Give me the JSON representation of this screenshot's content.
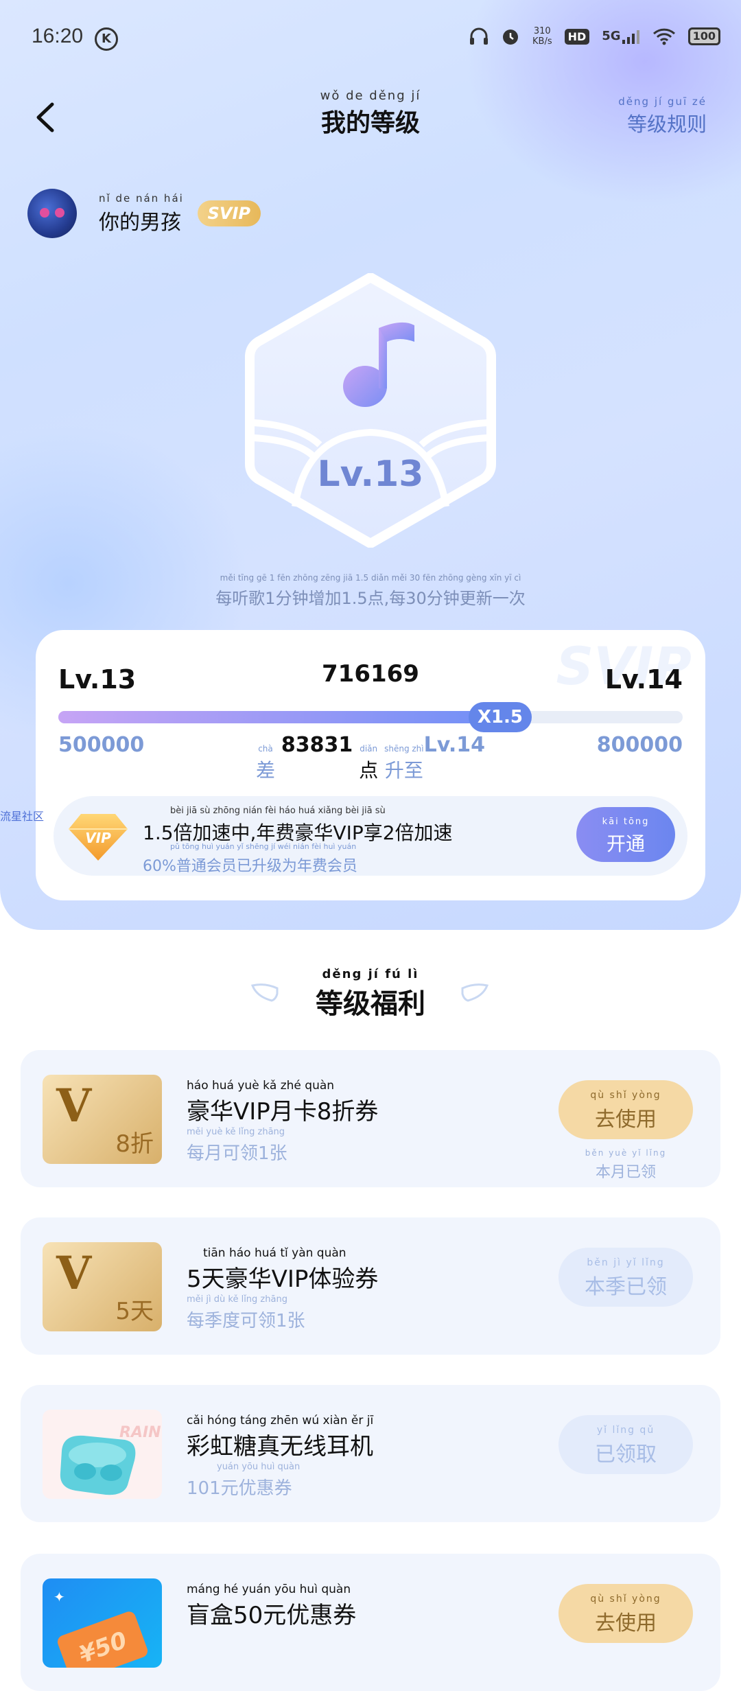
{
  "status_bar": {
    "time": "16:20",
    "k_badge": "K",
    "net_speed": "310",
    "net_unit": "KB/s",
    "hd": "HD",
    "network": "5G",
    "battery": "100"
  },
  "header": {
    "title": "我的等级",
    "title_pinyin": "wǒ de děng jí",
    "rules": "等级规则",
    "rules_pinyin": "děng jí guī zé"
  },
  "user": {
    "name": "你的男孩",
    "name_pinyin": "nǐ de nán hái",
    "badge": "SVIP"
  },
  "badge": {
    "level": "Lv.13"
  },
  "level_rule": {
    "text": "每听歌1分钟增加1.5点,每30分钟更新一次",
    "pinyin": "měi tīng gē 1 fēn zhōng zēng jiā 1.5 diǎn měi 30 fēn zhōng gèng xīn yī cì"
  },
  "progress": {
    "watermark": "SVIP",
    "current_level": "Lv.13",
    "next_level": "Lv.14",
    "score": "716169",
    "min": "500000",
    "max": "800000",
    "fraction": 0.723,
    "multiplier": "X1.5",
    "gap_prefix": "差",
    "gap_prefix_pinyin": "chà",
    "gap_value": "83831",
    "gap_unit": "点",
    "gap_unit_pinyin": "diǎn",
    "gap_suffix": "升至",
    "gap_suffix_pinyin": "shēng zhì",
    "gap_target": "Lv.14"
  },
  "promo": {
    "title": "1.5倍加速中,年费豪华VIP享2倍加速",
    "title_pinyin": "bèi jiā sù zhōng nián fèi háo huá xiǎng bèi jiā sù",
    "subtitle": "60%普通会员已升级为年费会员",
    "subtitle_pinyin": "pǔ tōng huì yuán yǐ shēng jí wéi nián fèi huì yuán",
    "button": "开通",
    "button_pinyin": "kāi tōng",
    "gem_label": "VIP"
  },
  "side_link": "流星社区",
  "welfare": {
    "title": "等级福利",
    "title_pinyin": "děng jí fú lì",
    "items": [
      {
        "name": "豪华VIP月卡8折券",
        "name_pinyin": "háo huá yuè kǎ zhé quàn",
        "sub": "每月可领1张",
        "sub_pinyin": "měi yuè kě lǐng zhāng",
        "thumb": "V",
        "thumb_tag": "8折",
        "button": "去使用",
        "button_pinyin": "qù shǐ yòng",
        "note": "本月已领",
        "note_pinyin": "běn yuè yǐ lǐng"
      },
      {
        "name": "5天豪华VIP体验券",
        "name_pinyin": "tiān háo huá tǐ yàn quàn",
        "sub": "每季度可领1张",
        "sub_pinyin": "měi jì dù kě lǐng zhāng",
        "thumb": "V",
        "thumb_tag": "5天",
        "button": "本季已领",
        "button_pinyin": "běn jì yǐ lǐng"
      },
      {
        "name": "彩虹糖真无线耳机",
        "name_pinyin": "cǎi hóng táng zhēn wú xiàn ěr jī",
        "sub": "101元优惠券",
        "sub_pinyin": "yuán yōu huì quàn",
        "thumb_text": "RAIN BOW CAN",
        "button": "已领取",
        "button_pinyin": "yǐ lǐng qǔ"
      },
      {
        "name": "盲盒50元优惠券",
        "name_pinyin": "máng hé yuán yōu huì quàn",
        "thumb_tag": "¥50",
        "button": "去使用",
        "button_pinyin": "qù shǐ yòng"
      }
    ]
  },
  "colors": {
    "accent": "#6486ea",
    "gold": "#f5d9a5",
    "bg": "#d3e2ff"
  }
}
